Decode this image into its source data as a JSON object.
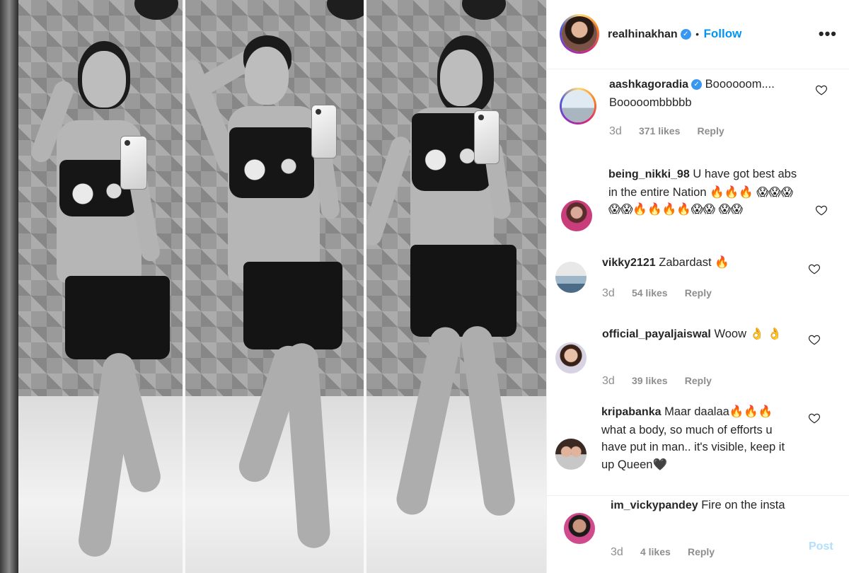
{
  "post": {
    "username": "realhinakhan",
    "follow_label": "Follow",
    "dot": "•",
    "more_label": "•••",
    "verified": true
  },
  "comments": [
    {
      "username": "aashkagoradia",
      "verified": true,
      "text": "Boooooom.... Booooombbbbb",
      "time": "3d",
      "likes": "371 likes",
      "reply": "Reply"
    },
    {
      "username": "being_nikki_98",
      "text": "U have got best abs in the entire Nation 🔥🔥🔥 😱😱😱😱😱🔥🔥🔥🔥😱😱 😱😱"
    },
    {
      "username": "vikky2121",
      "text": "Zabardast 🔥",
      "time": "3d",
      "likes": "54 likes",
      "reply": "Reply"
    },
    {
      "username": "official_payaljaiswal",
      "text": "Woow 👌 👌",
      "time": "3d",
      "likes": "39 likes",
      "reply": "Reply"
    },
    {
      "username": "kripabanka",
      "text": "Maar daalaa🔥🔥🔥 what a body, so much of efforts u have put in man.. it's visible, keep it up Queen🖤"
    },
    {
      "username": "im_vickypandey",
      "text": "Fire on the insta",
      "time": "3d",
      "likes": "4 likes",
      "reply": "Reply"
    }
  ],
  "post_button": "Post",
  "colors": {
    "link": "#0095f6",
    "verified": "#3897f0",
    "muted": "#8e8e8e"
  }
}
